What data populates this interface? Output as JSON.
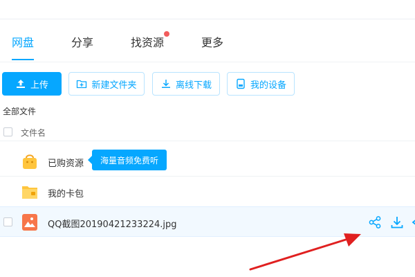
{
  "nav": {
    "tabs": [
      {
        "label": "网盘",
        "active": true
      },
      {
        "label": "分享"
      },
      {
        "label": "找资源",
        "has_dot": true
      },
      {
        "label": "更多"
      }
    ]
  },
  "toolbar": {
    "upload": "上传",
    "new_folder": "新建文件夹",
    "offline_download": "离线下载",
    "my_devices": "我的设备"
  },
  "breadcrumb": "全部文件",
  "list": {
    "header_name": "文件名",
    "rows": [
      {
        "name": "已购资源",
        "icon": "shopping-bag-icon"
      },
      {
        "name": "我的卡包",
        "icon": "card-folder-icon"
      },
      {
        "name": "QQ截图20190421233224.jpg",
        "icon": "image-file-icon"
      }
    ]
  },
  "tooltip": "海量音频免费听",
  "colors": {
    "accent": "#06a7ff",
    "dot": "#f25d5d",
    "arrow": "#e02020"
  }
}
